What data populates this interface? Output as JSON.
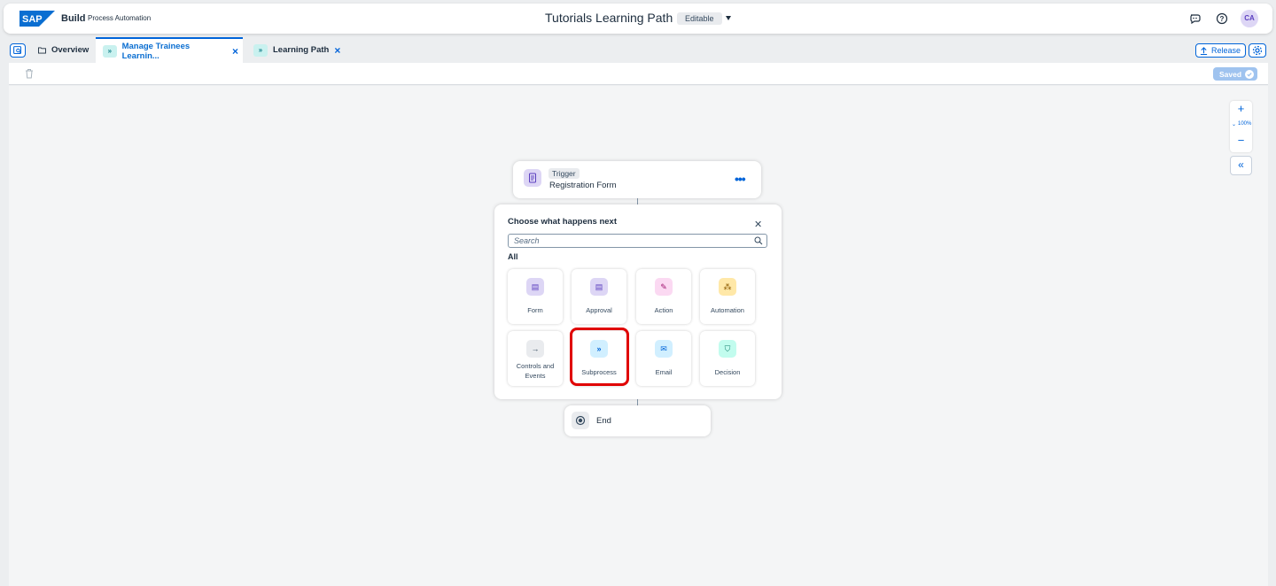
{
  "shell": {
    "logo_text": "SAP",
    "brand": "Build",
    "product": "Process Automation",
    "title": "Tutorials Learning Path",
    "mode_badge": "Editable",
    "avatar_initials": "CA"
  },
  "tabs": {
    "overview_label": "Overview",
    "items": [
      {
        "label": "Manage Trainees Learnin...",
        "icon": "subprocess-icon",
        "active": true
      },
      {
        "label": "Learning Path",
        "icon": "subprocess-icon",
        "active": false
      }
    ],
    "release_label": "Release"
  },
  "toolbar": {
    "saved_label": "Saved"
  },
  "canvas": {
    "zoom_level": "100%",
    "trigger": {
      "tag": "Trigger",
      "name": "Registration Form"
    },
    "next_panel": {
      "title": "Choose what happens next",
      "search_placeholder": "Search",
      "section": "All",
      "options": [
        {
          "label": "Form",
          "icon": "form-icon",
          "color": "#ddd6f5"
        },
        {
          "label": "Approval",
          "icon": "approval-icon",
          "color": "#ddd6f5"
        },
        {
          "label": "Action",
          "icon": "action-icon",
          "color": "#fbd9f2"
        },
        {
          "label": "Automation",
          "icon": "automation-icon",
          "color": "#ffe8a8"
        },
        {
          "label": "Controls and Events",
          "icon": "arrow-right-icon",
          "color": "#e9ebee"
        },
        {
          "label": "Subprocess",
          "icon": "subprocess-icon",
          "color": "#d1efff"
        },
        {
          "label": "Email",
          "icon": "email-icon",
          "color": "#d1efff"
        },
        {
          "label": "Decision",
          "icon": "decision-icon",
          "color": "#c2fcee"
        }
      ]
    },
    "end": {
      "label": "End"
    }
  },
  "colors": {
    "accent": "#0064d9",
    "highlight": "#e00000"
  }
}
